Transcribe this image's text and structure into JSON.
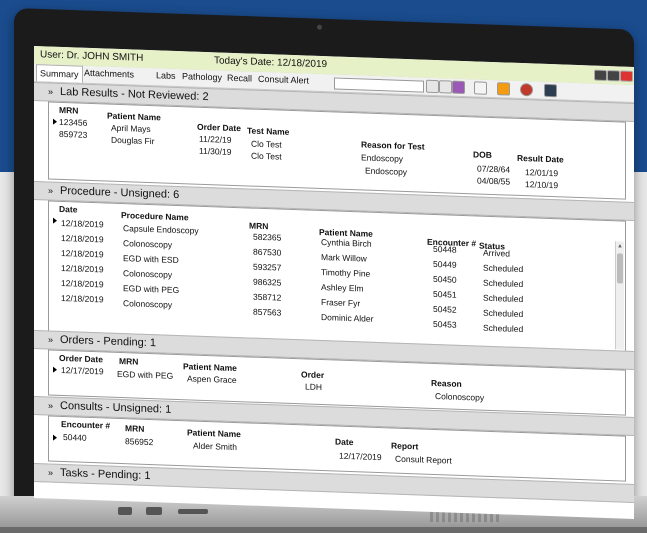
{
  "header": {
    "user": "User: Dr. JOHN SMITH",
    "today": "Today's Date: 12/18/2019"
  },
  "tabs": [
    "Summary",
    "Attachments",
    "Labs",
    "Pathology",
    "Recall",
    "Consult Alert"
  ],
  "lab_results": {
    "title": "Lab Results - Not Reviewed: 2",
    "headers": [
      "MRN",
      "Patient Name",
      "Order Date",
      "Test Name",
      "Reason for Test",
      "DOB",
      "Result Date"
    ],
    "rows": [
      [
        "123456",
        "April Mays",
        "11/22/19",
        "Clo Test",
        "Endoscopy",
        "07/28/64",
        "12/01/19"
      ],
      [
        "859723",
        "Douglas Fir",
        "11/30/19",
        "Clo Test",
        "Endoscopy",
        "04/08/55",
        "12/10/19"
      ]
    ]
  },
  "procedures": {
    "title": "Procedure - Unsigned: 6",
    "headers": [
      "Date",
      "Procedure Name",
      "MRN",
      "Patient Name",
      "Encounter #",
      "Status"
    ],
    "rows": [
      [
        "12/18/2019",
        "Capsule Endoscopy",
        "582365",
        "Cynthia Birch",
        "50448",
        "Arrived"
      ],
      [
        "12/18/2019",
        "Colonoscopy",
        "867530",
        "Mark Willow",
        "50449",
        "Scheduled"
      ],
      [
        "12/18/2019",
        "EGD with ESD",
        "593257",
        "Timothy Pine",
        "50450",
        "Scheduled"
      ],
      [
        "12/18/2019",
        "Colonoscopy",
        "986325",
        "Ashley Elm",
        "50451",
        "Scheduled"
      ],
      [
        "12/18/2019",
        "EGD with PEG",
        "358712",
        "Fraser Fyr",
        "50452",
        "Scheduled"
      ],
      [
        "12/18/2019",
        "Colonoscopy",
        "857563",
        "Dominic Alder",
        "50453",
        "Scheduled"
      ]
    ]
  },
  "orders": {
    "title": "Orders - Pending: 1",
    "headers": [
      "Order Date",
      "MRN",
      "Patient Name",
      "Order",
      "Reason"
    ],
    "rows": [
      [
        "12/17/2019",
        "EGD with PEG",
        "Aspen Grace",
        "LDH",
        "Colonoscopy"
      ]
    ]
  },
  "consults": {
    "title": "Consults - Unsigned: 1",
    "headers": [
      "Encounter #",
      "MRN",
      "Patient Name",
      "Date",
      "Report"
    ],
    "rows": [
      [
        "50440",
        "856952",
        "Alder Smith",
        "12/17/2019",
        "Consult Report"
      ]
    ]
  },
  "tasks": {
    "title": "Tasks - Pending: 1"
  },
  "colors": {
    "background_blue": "#1a4c8e",
    "header_green": "#e6f1c8"
  }
}
